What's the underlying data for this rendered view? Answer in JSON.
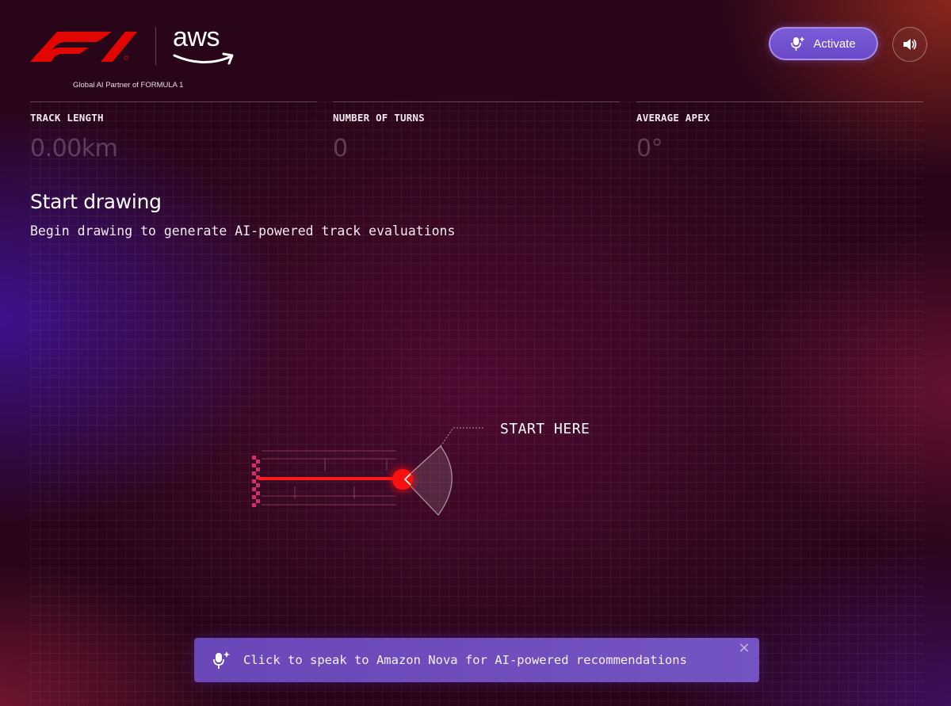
{
  "header": {
    "aws_text": "aws",
    "partner_text": "Global AI Partner of FORMULA 1",
    "activate_label": "Activate"
  },
  "stats": [
    {
      "label": "TRACK LENGTH",
      "value": "0.00km"
    },
    {
      "label": "NUMBER OF TURNS",
      "value": "0"
    },
    {
      "label": "AVERAGE APEX",
      "value": "0°"
    }
  ],
  "main": {
    "heading": "Start drawing",
    "subheading": "Begin drawing to generate AI-powered track evaluations",
    "start_label": "START HERE"
  },
  "banner": {
    "text": "Click to speak to Amazon Nova for AI-powered recommendations",
    "close": "×"
  },
  "icons": {
    "activate": "mic-sparkle-icon",
    "sound": "speaker-icon",
    "banner": "mic-sparkle-icon",
    "close": "close-icon"
  },
  "colors": {
    "f1_red": "#e10600",
    "accent_purple": "#6c4bc4",
    "track_red": "#ff1a1a"
  }
}
